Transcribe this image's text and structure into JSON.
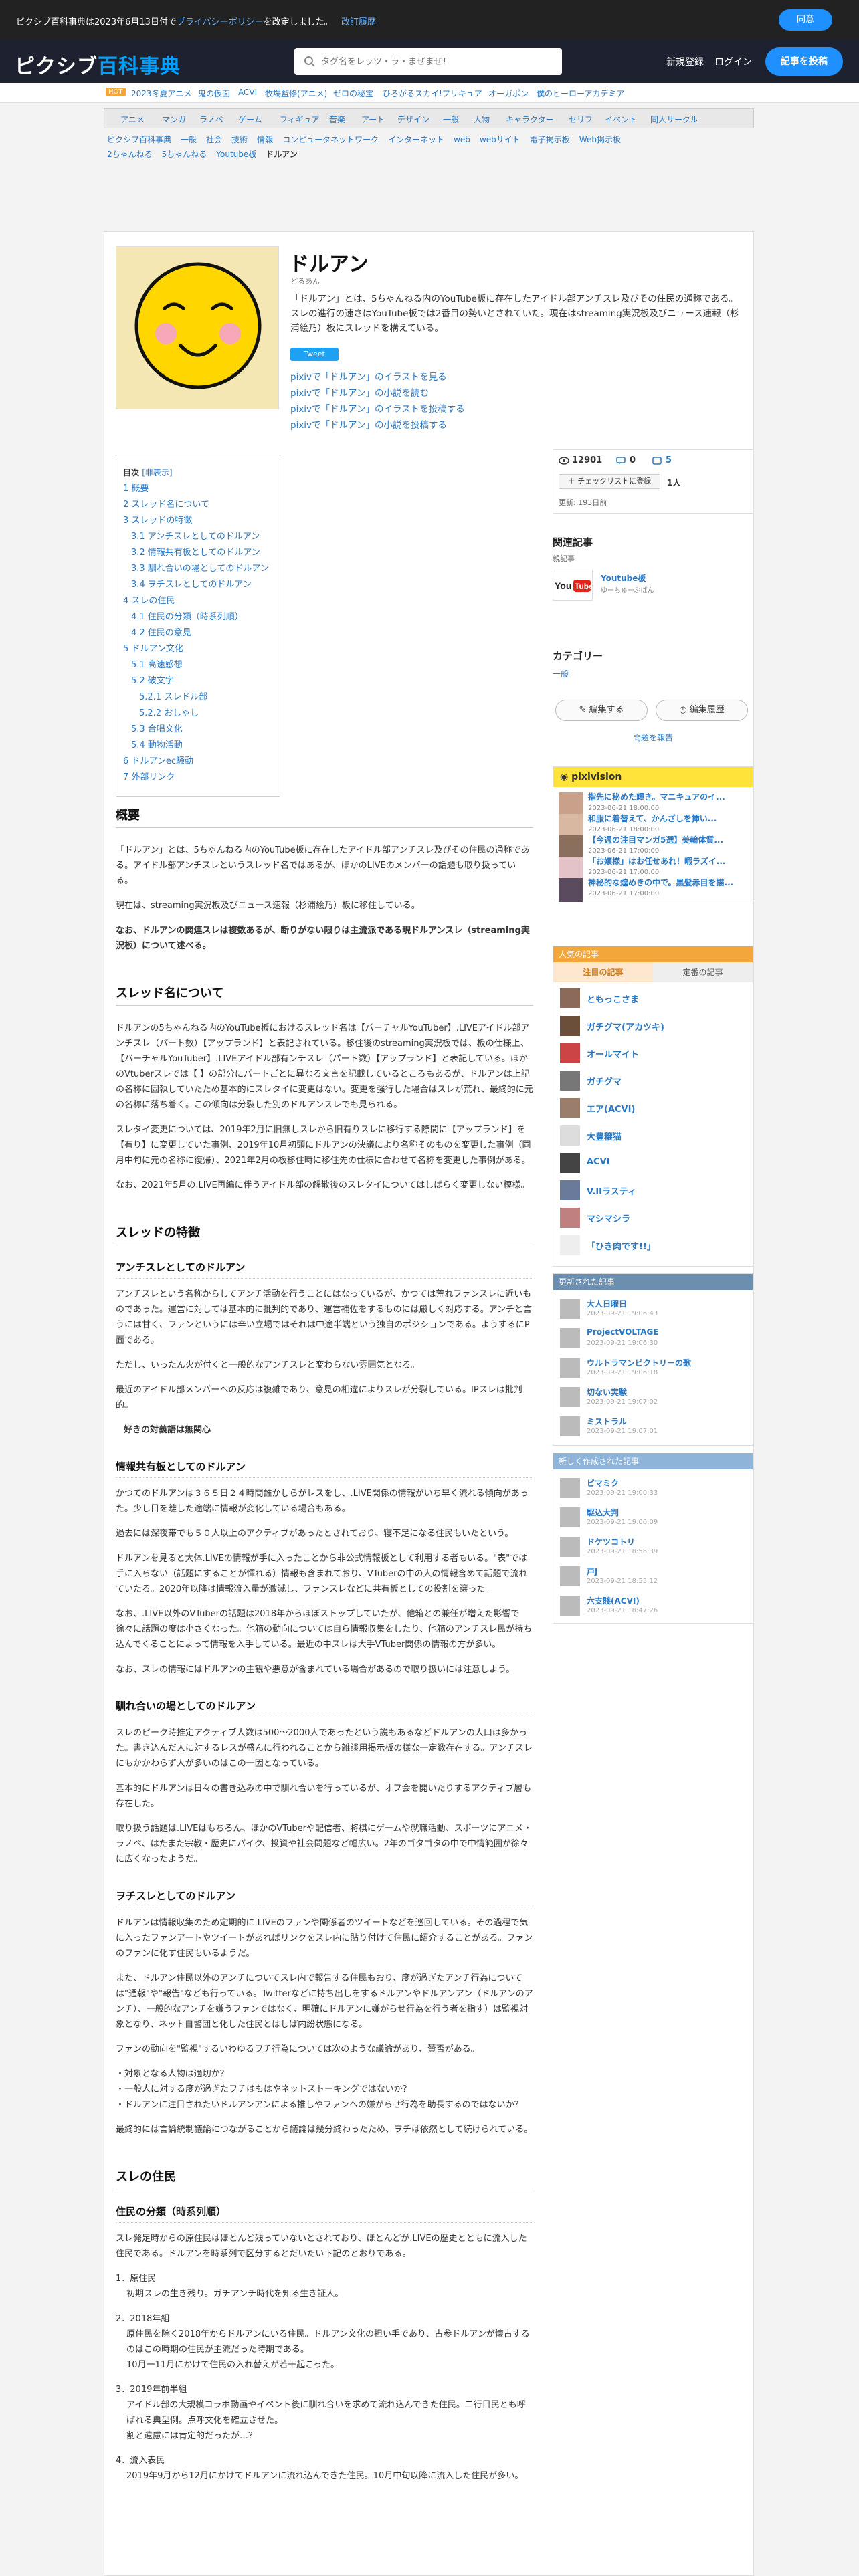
{
  "cookie": {
    "message": "ピクシブ百科事典は2023年6月13日付で",
    "policy_link": "プライバシーポリシー",
    "message_tail": "を改定しました。",
    "history_link": "改訂履歴",
    "agree": "同意"
  },
  "header": {
    "logo_main": "ピクシブ",
    "logo_sub": "百科事典",
    "search_placeholder": "タグ名をレッツ・ラ・まぜまぜ！",
    "register": "新規登録",
    "login": "ログイン",
    "post": "記事を投稿"
  },
  "news": {
    "badge": "HOT",
    "items": [
      "2023冬夏アニメ",
      "鬼の仮面",
      "ACVI",
      "牧場監修(アニメ)",
      "ゼロの秘宝",
      "ひろがるスカイ!プリキュア",
      "オーガポン",
      "僕のヒーローアカデミア"
    ]
  },
  "categories": [
    "アニメ",
    "マンガ",
    "ラノベ",
    "ゲーム",
    "フィギュア",
    "音楽",
    "アート",
    "デザイン",
    "一般",
    "人物",
    "キャラクター",
    "セリフ",
    "イベント",
    "同人サークル"
  ],
  "breadcrumbs": [
    "ピクシブ百科事典",
    "一般",
    "社会",
    "技術",
    "情報",
    "コンピュータネットワーク",
    "インターネット",
    "web",
    "webサイト",
    "電子掲示板",
    "Web掲示板",
    "2ちゃんねる",
    "5ちゃんねる",
    "Youtube板",
    "ドルアン"
  ],
  "article": {
    "title": "ドルアン",
    "reading": "どるあん",
    "summary": "「ドルアン」とは、5ちゃんねる内のYouTube板に存在したアイドル部アンチスレ及びその住民の通称である。スレの進行の速さはYouTube板では2番目の勢いとされていた。現在はstreaming実況板及びニュース速報（杉浦絵乃）板にスレッドを構えている。",
    "tweet": "Tweet",
    "pixiv_links": [
      "pixivで「ドルアン」のイラストを見る",
      "pixivで「ドルアン」の小説を読む",
      "pixivで「ドルアン」のイラストを投稿する",
      "pixivで「ドルアン」の小説を投稿する"
    ]
  },
  "toc": {
    "heading": "目次",
    "toggle": "[非表示]",
    "items": [
      {
        "t": "1 概要",
        "l": 1
      },
      {
        "t": "2 スレッド名について",
        "l": 1
      },
      {
        "t": "3 スレッドの特徴",
        "l": 1
      },
      {
        "t": "3.1 アンチスレとしてのドルアン",
        "l": 2
      },
      {
        "t": "3.2 情報共有板としてのドルアン",
        "l": 2
      },
      {
        "t": "3.3 馴れ合いの場としてのドルアン",
        "l": 2
      },
      {
        "t": "3.4 ヲチスレとしてのドルアン",
        "l": 2
      },
      {
        "t": "4 スレの住民",
        "l": 1
      },
      {
        "t": "4.1 住民の分類（時系列順）",
        "l": 2
      },
      {
        "t": "4.2 住民の意見",
        "l": 2
      },
      {
        "t": "5 ドルアン文化",
        "l": 1
      },
      {
        "t": "5.1 高速感想",
        "l": 2
      },
      {
        "t": "5.2 破文字",
        "l": 2
      },
      {
        "t": "5.2.1 スレドル部",
        "l": 3
      },
      {
        "t": "5.2.2 おしゃし",
        "l": 3
      },
      {
        "t": "5.3 合唱文化",
        "l": 2
      },
      {
        "t": "5.4 動物活動",
        "l": 2
      },
      {
        "t": "6 ドルアンec騒動",
        "l": 1
      },
      {
        "t": "7 外部リンク",
        "l": 1
      }
    ]
  },
  "sections": {
    "s1_title": "概要",
    "s1_p1": "「ドルアン」とは、5ちゃんねる内のYouTube板に存在したアイドル部アンチスレ及びその住民の通称である。アイドル部アンチスレというスレッド名ではあるが、ほかのLIVEのメンバーの話題も取り扱っている。",
    "s1_p2": "現在は、streaming実況板及びニュース速報（杉浦絵乃）板に移住している。",
    "s1_p3": "なお、ドルアンの関連スレは複数あるが、断りがない限りは主流派である現ドルアンスレ（streaming実況板）について述べる。",
    "s2_title": "スレッド名について",
    "s2_p1": "ドルアンの5ちゃんねる内のYouTube板におけるスレッド名は【バーチャルYouTuber】.LIVEアイドル部アンチスレ（パート数）【アップランド】と表記されている。移住後のstreaming実況板では、板の仕様上、【バーチャルYouTuber】.LIVEアイドル部有ンチスレ（パート数）【アップランド】と表記している。ほかのVtuberスレでは【 】の部分にパートごとに異なる文言を記載しているところもあるが、ドルアンは上記の名称に固執していたため基本的にスレタイに変更はない。変更を強行した場合はスレが荒れ、最終的に元の名称に落ち着く。この傾向は分裂した別のドルアンスレでも見られる。",
    "s2_p2": "スレタイ変更については、2019年2月に旧無しスレから旧有りスレに移行する際間に【アップランド】を【有り】に変更していた事例、2019年10月初頭にドルアンの決議により名称そのものを変更した事例（同月中旬に元の名称に復帰）、2021年2月の板移住時に移住先の仕様に合わせて名称を変更した事例がある。",
    "s2_p3": "なお、2021年5月の.LIVE再編に伴うアイドル部の解散後のスレタイについてはしばらく変更しない模様。",
    "s3_title": "スレッドの特徴",
    "s3_1_title": "アンチスレとしてのドルアン",
    "s3_1_p1": "アンチスレという名称からしてアンチ活動を行うことにはなっているが、かつては荒れファンスレに近いものであった。運営に対しては基本的に批判的であり、運営補佐をするものには厳しく対応する。アンチと言うには甘く、ファンというには辛い立場ではそれは中途半端という独自のポジションである。ようするにP面である。",
    "s3_1_p2": "ただし、いったん火が付くと一般的なアンチスレと変わらない雰囲気となる。",
    "s3_1_p3": "最近のアイドル部メンバーへの反応は複雑であり、意見の相違によりスレが分裂している。IPスレは批判的。",
    "s3_1_note": "好きの対義語は無関心",
    "s3_2_title": "情報共有板としてのドルアン",
    "s3_2_p1": "かつてのドルアンは３６５日２４時間誰かしらがレスをし、.LIVE関係の情報がいち早く流れる傾向があった。少し目を離した途端に情報が変化している場合もある。",
    "s3_2_p2": "過去には深夜帯でも５０人以上のアクティブがあったとされており、寝不足になる住民もいたという。",
    "s3_2_p3": "ドルアンを見ると大体.LIVEの情報が手に入ったことから非公式情報板として利用する者もいる。\"表\"では手に入らない（話題にすることが憚れる）情報も含まれており、VTuberの中の人の情報含めて話題で流れていたる。2020年以降は情報流入量が激減し、ファンスレなどに共有板としての役割を譲った。",
    "s3_2_p4": "なお、.LIVE以外のVTuberの話題は2018年からほぼストップしていたが、他箱との兼任が増えた影響で徐々に話題の度は小さくなった。他箱の動向については自ら情報収集をしたり、他箱のアンチスレ民が持ち込んでくることによって情報を入手している。最近の中スレは大手VTuber関係の情報の方が多い。",
    "s3_2_p5": "なお、スレの情報にはドルアンの主観や悪意が含まれている場合があるので取り扱いには注意しよう。",
    "s3_3_title": "馴れ合いの場としてのドルアン",
    "s3_3_p1": "スレのピーク時推定アクティブ人数は500～2000人であったという説もあるなどドルアンの人口は多かった。書き込んだ人に対するレスが盛んに行われることから雑談用掲示板の様な一定数存在する。アンチスレにもかかわらず人が多いのはこの一因となっている。",
    "s3_3_p2": "基本的にドルアンは日々の書き込みの中で馴れ合いを行っているが、オフ会を開いたりするアクティブ層も存在した。",
    "s3_3_p3": "取り扱う話題は.LIVEはもちろん、ほかのVTuberや配信者、将棋にゲームや就職活動、スポーツにアニメ・ラノベ、はたまた宗教・歴史にパイク、投資や社会問題など幅広い。2年のゴタゴタの中で中情範囲が徐々に広くなったようだ。",
    "s3_4_title": "ヲチスレとしてのドルアン",
    "s3_4_p1": "ドルアンは情報収集のため定期的に.LIVEのファンや関係者のツイートなどを巡回している。その過程で気に入ったファンアートやツイートがあればリンクをスレ内に貼り付けて住民に紹介することがある。ファンのファンに化す住民もいるようだ。",
    "s3_4_p2": "また、ドルアン住民以外のアンチについてスレ内で報告する住民もおり、度が過ぎたアンチ行為については\"通報\"や\"報告\"なども行っている。Twitterなどに持ち出しをするドルアンやドルアンアン（ドルアンのアンチ）、一般的なアンチを嫌うファンではなく、明確にドルアンに嫌がらせ行為を行う者を指す）は監視対象となり、ネット自警団と化した住民とはしば内紛状態になる。",
    "s3_4_p3": "ファンの動向を\"監視\"するいわゆるヲチ行為については次のような議論があり、賛否がある。",
    "s3_4_q1": "・対象となる人物は適切か？",
    "s3_4_q2": "・一般人に対する度が過ぎたヲチはもはやネットストーキングではないか？",
    "s3_4_q3": "・ドルアンに注目されたいドルアンアンによる推しやファンへの嫌がらせ行為を助長するのではないか？",
    "s3_4_p4": "最終的には言論統制議論につながることから議論は幾分終わったため、ヲチは依然として続けられている。",
    "s4_title": "スレの住民",
    "s4_1_title": "住民の分類（時系列順）",
    "s4_1_p1": "スレ発足時からの原住民はほとんど残っていないとされており、ほとんどが.LIVEの歴史とともに流入した住民である。ドルアンを時系列で区分するとだいたい下記のとおりである。",
    "s4_l1": "1．原住民",
    "s4_l1a": "初期スレの生き残り。ガチアンチ時代を知る生き証人。",
    "s4_l2": "2．2018年組",
    "s4_l2a": "原住民を除く2018年からドルアンにいる住民。ドルアン文化の担い手であり、古参ドルアンが懐古するのはこの時期の住民が主流だった時期である。",
    "s4_l2b": "10月一11月にかけて住民の入れ替えが若干起こった。",
    "s4_l3": "3．2019年前半組",
    "s4_l3a": "アイドル部の大規模コラボ動画やイベント後に馴れ合いを求めて流れ込んできた住民。二行目民とも呼ばれる典型例。点呼文化を確立させた。",
    "s4_l3b": "割と遠慮には肯定的だったが…？",
    "s4_l4": "4．流入表民",
    "s4_l4a": "2019年9月から12月にかけてドルアンに流れ込んできた住民。10月中旬以降に流入した住民が多い。"
  },
  "stats": {
    "views": "12901",
    "comments": "0",
    "pixiv_count": "5",
    "checklist": "チェックリストに登録",
    "checklist_count": "1人",
    "updated": "更新: 193日前"
  },
  "related": {
    "heading": "関連記事",
    "subheading": "親記事",
    "parent_title": "Youtube板",
    "parent_sub": "ゆーちゅーぶばん"
  },
  "category_box": {
    "heading": "カテゴリー",
    "value": "一般"
  },
  "edit": {
    "edit_btn": "編集する",
    "history_btn": "編集履歴",
    "report": "問題を報告"
  },
  "pixivision": {
    "heading": "pixivision",
    "items": [
      {
        "t": "指先に秘めた輝き。マニキュアのイ...",
        "d": "2023-06-21 18:00:00"
      },
      {
        "t": "和服に着替えて、かんざしを挿い...",
        "d": "2023-06-21 18:00:00"
      },
      {
        "t": "【今週の注目マンガ5選】美輪体質...",
        "d": "2023-06-21 17:00:00"
      },
      {
        "t": "「お嬢様」はお任せあれ！暇ラズイ...",
        "d": "2023-06-21 17:00:00"
      },
      {
        "t": "神秘的な煌めきの中で。黒髪赤目を描...",
        "d": "2023-06-21 17:00:00"
      }
    ]
  },
  "popular": {
    "heading": "人気の記事",
    "tab_popular": "注目の記事",
    "tab_standard": "定番の記事",
    "items": [
      "ともっこさま",
      "ガチグマ(アカツキ)",
      "オールマイト",
      "ガチグマ",
      "エア(ACVI)",
      "大豊穣猫",
      "ACVI",
      "V.IIラスティ",
      "マシマシラ",
      "「ひき肉です!!」"
    ]
  },
  "updated_box": {
    "heading": "更新された記事",
    "items": [
      {
        "t": "大人日曜日",
        "d": "2023-09-21 19:06:43"
      },
      {
        "t": "ProjectVOLTAGE",
        "d": "2023-09-21 19:06:30"
      },
      {
        "t": "ウルトラマンビクトリーの歌",
        "d": "2023-09-21 19:06:18"
      },
      {
        "t": "切ない実験",
        "d": "2023-09-21 19:07:02"
      },
      {
        "t": "ミストラル",
        "d": "2023-09-21 19:07:01"
      }
    ]
  },
  "new_box": {
    "heading": "新しく作成された記事",
    "items": [
      {
        "t": "ビマミク",
        "d": "2023-09-21 19:00:33"
      },
      {
        "t": "駆込大判",
        "d": "2023-09-21 19:00:09"
      },
      {
        "t": "ドケツコトリ",
        "d": "2023-09-21 18:56:39"
      },
      {
        "t": "戸J",
        "d": "2023-09-21 18:55:12"
      },
      {
        "t": "六支賤(ACVI)",
        "d": "2023-09-21 18:47:26"
      }
    ]
  }
}
